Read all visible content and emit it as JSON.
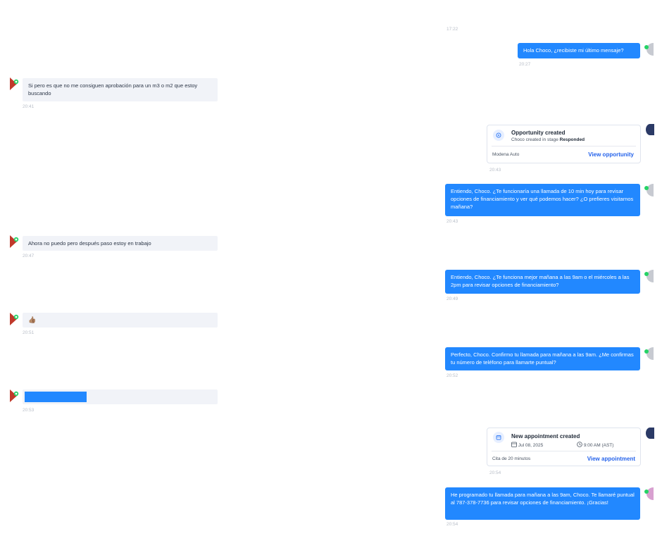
{
  "messages": {
    "top_time": "17:22",
    "m1": {
      "text": "Hola Choco, ¿recibiste mi último mensaje?",
      "time": "20:27"
    },
    "m2": {
      "text": "Si pero es que no me consiguen aprobación para un m3 o m2 que estoy buscando",
      "time": "20:41"
    },
    "card1": {
      "title": "Opportunity created",
      "subtitle_prefix": "Choco created in stage ",
      "subtitle_stage": "Responded",
      "footer_left": "Modena Auto",
      "link": "View opportunity",
      "time": "20:43"
    },
    "m3": {
      "text": "Entiendo, Choco. ¿Te funcionaría una llamada de 10 min hoy para revisar opciones de financiamiento y ver qué podemos hacer? ¿O prefieres visitarnos mañana?",
      "time": "20:43"
    },
    "m4": {
      "text": "Ahora no puedo pero después paso estoy en trabajo",
      "time": "20:47"
    },
    "m5": {
      "text": "Entiendo, Choco. ¿Te funciona mejor mañana a las 9am o el miércoles a las 2pm para revisar opciones de financiamiento?",
      "time": "20:49"
    },
    "m6": {
      "text": "👍🏽",
      "time": "20:51"
    },
    "m7": {
      "text": "Perfecto, Choco. Confirmo tu llamada para mañana a las 9am. ¿Me confirmas tu número de teléfono para llamarte puntual?",
      "time": "20:52"
    },
    "m8": {
      "time": "20:53"
    },
    "card2": {
      "title": "New appointment created",
      "date": "Jul 08, 2025",
      "time_slot": "9:00 AM (AST)",
      "footer_left": "Cita de 20 minutos",
      "link": "View appointment",
      "time": "20:54"
    },
    "m9": {
      "text": "He programado tu llamada para mañana a las 9am, Choco. Te llamaré puntual al 787-378-7736 para revisar opciones de financiamiento. ¡Gracias!",
      "time": "20:54"
    }
  },
  "colors": {
    "outgoing": "#2288ff",
    "incoming": "#f1f3f8",
    "link": "#2563eb",
    "whatsapp_green": "#25d366",
    "avatar_red": "#c0392b"
  },
  "icons": {
    "channel": "whatsapp-icon",
    "opportunity": "opportunity-icon",
    "calendar": "calendar-icon",
    "clock": "clock-icon"
  }
}
